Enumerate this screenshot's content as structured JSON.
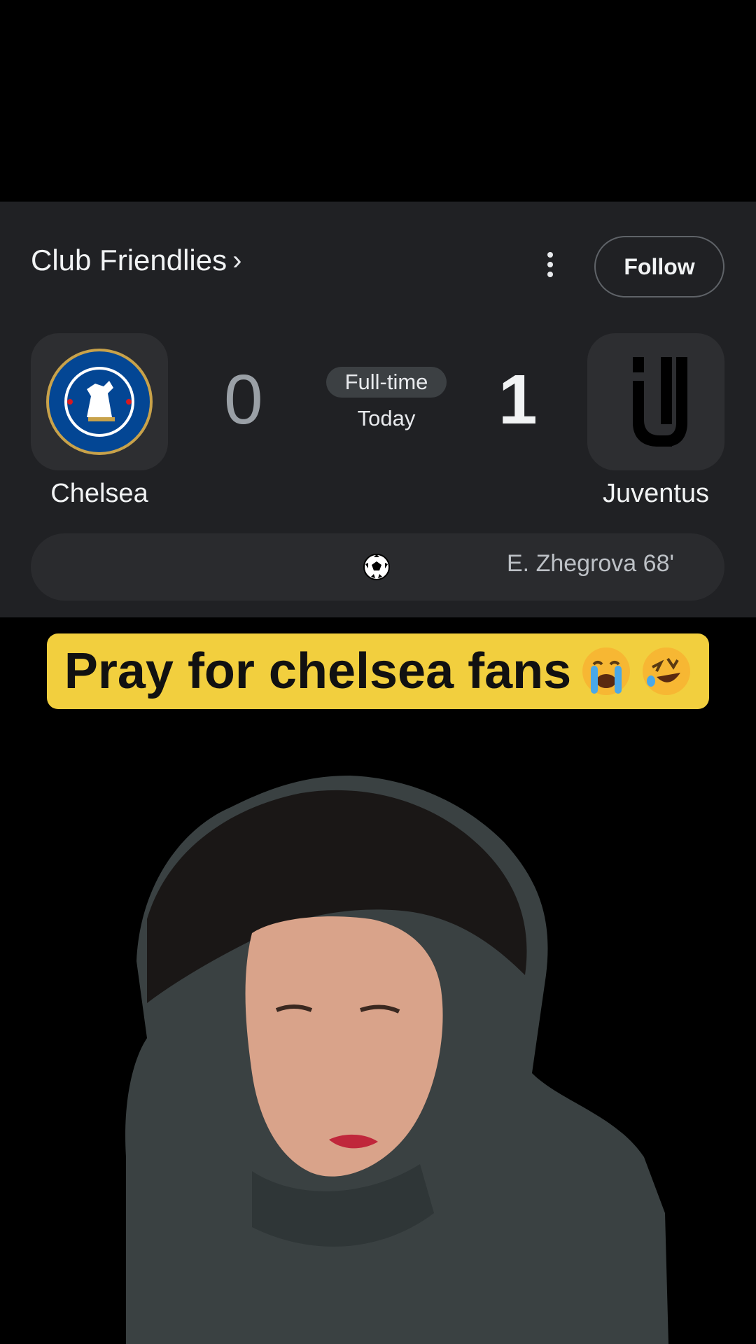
{
  "match_card": {
    "league_label": "Club Friendlies",
    "league_chevron": "›",
    "follow_label": "Follow",
    "home_team": {
      "name": "Chelsea",
      "score": "0",
      "crest_icon": "chelsea-crest-icon"
    },
    "away_team": {
      "name": "Juventus",
      "score": "1",
      "crest_icon": "juventus-crest-icon"
    },
    "status": "Full-time",
    "date": "Today",
    "scorer": "E. Zhegrova 68'"
  },
  "caption": {
    "text": "Pray for chelsea fans",
    "emojis": [
      "loudly-crying-face-emoji",
      "rolling-on-floor-laughing-emoji"
    ],
    "background": "#f2cf3e"
  },
  "colors": {
    "card_bg": "#202124",
    "chelsea_blue": "#034694",
    "caption_yellow": "#f2cf3e"
  }
}
